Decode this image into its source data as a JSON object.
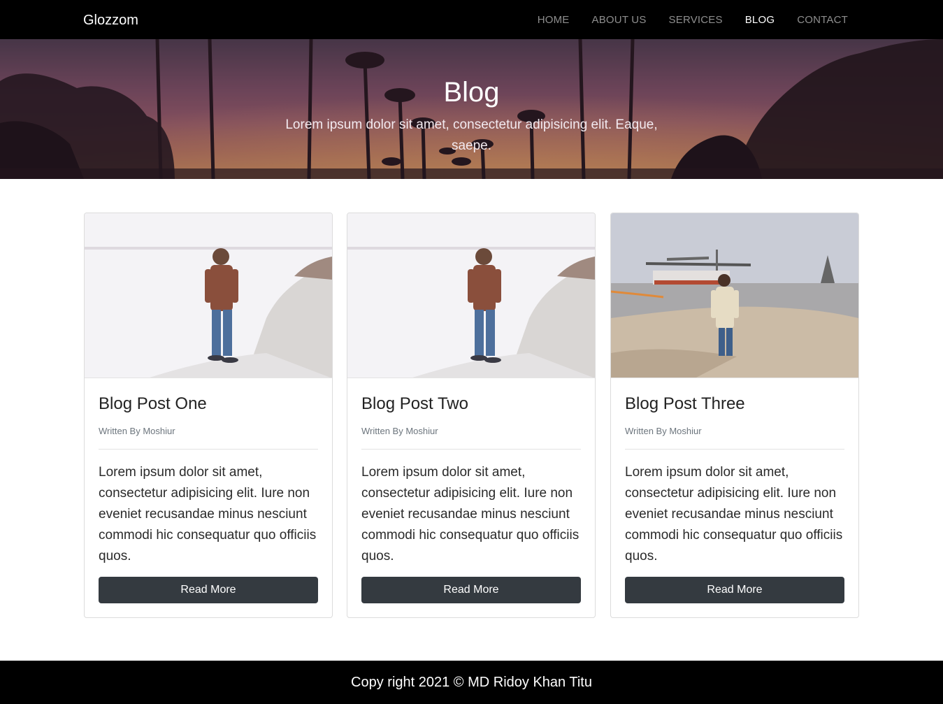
{
  "navbar": {
    "brand": "Glozzom",
    "links": [
      {
        "label": "HOME",
        "active": false
      },
      {
        "label": "ABOUT US",
        "active": false
      },
      {
        "label": "SERVICES",
        "active": false
      },
      {
        "label": "BLOG",
        "active": true
      },
      {
        "label": "CONTACT",
        "active": false
      }
    ]
  },
  "hero": {
    "title": "Blog",
    "subtitle": "Lorem ipsum dolor sit amet, consectetur adipisicing elit. Eaque, saepe."
  },
  "posts": [
    {
      "title": "Blog Post One",
      "author": "Written By Moshiur",
      "body": "Lorem ipsum dolor sit amet, consectetur adipisicing elit. Iure non eveniet recusandae minus nesciunt commodi hic consequatur quo officiis quos.",
      "button": "Read More"
    },
    {
      "title": "Blog Post Two",
      "author": "Written By Moshiur",
      "body": "Lorem ipsum dolor sit amet, consectetur adipisicing elit. Iure non eveniet recusandae minus nesciunt commodi hic consequatur quo officiis quos.",
      "button": "Read More"
    },
    {
      "title": "Blog Post Three",
      "author": "Written By Moshiur",
      "body": "Lorem ipsum dolor sit amet, consectetur adipisicing elit. Iure non eveniet recusandae minus nesciunt commodi hic consequatur quo officiis quos.",
      "button": "Read More"
    }
  ],
  "footer": {
    "text": "Copy right 2021 © MD Ridoy Khan Titu"
  },
  "colors": {
    "navbar_bg": "#000000",
    "button_bg": "#343a40",
    "footer_bg": "#000000"
  }
}
